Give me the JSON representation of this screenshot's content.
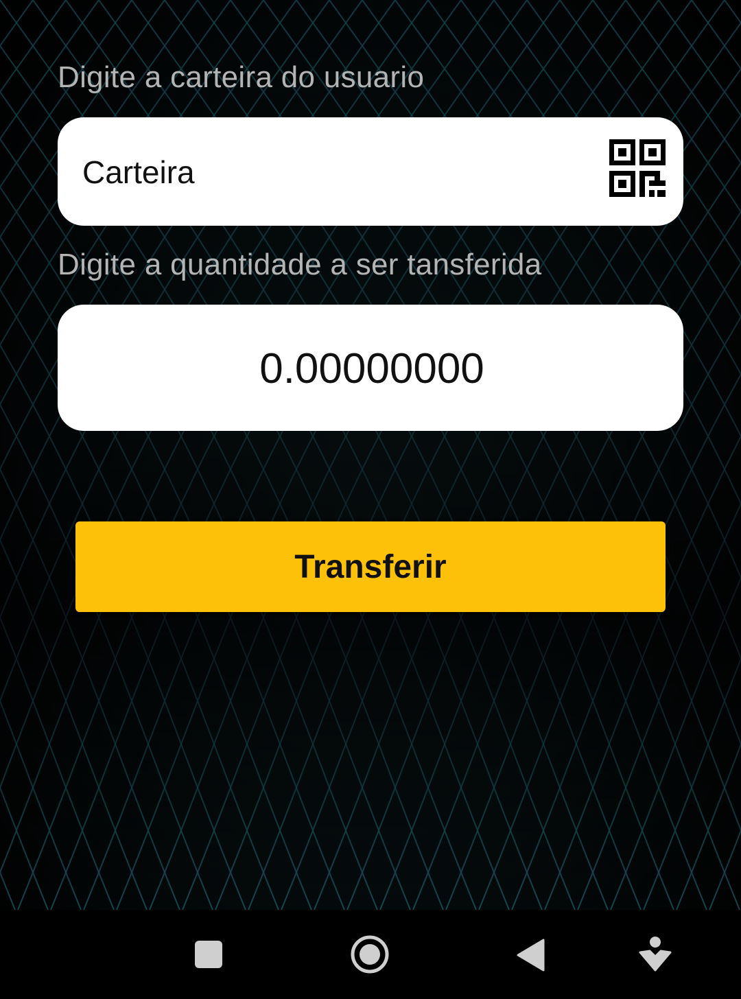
{
  "wallet": {
    "label": "Digite a carteira do usuario",
    "placeholder": "Carteira",
    "qr_icon": "qr-code-icon"
  },
  "amount": {
    "label": "Digite a quantidade a ser tansferida",
    "value": "0.00000000"
  },
  "actions": {
    "transfer_label": "Transferir"
  },
  "nav_bar": {
    "icons": [
      "recents-square-icon",
      "home-circle-icon",
      "back-triangle-icon",
      "accessibility-person-icon"
    ]
  },
  "colors": {
    "button": "#fdc10a",
    "grid_lines": "#1f6a78",
    "field_bg": "#ffffff",
    "label_text": "#b4b4b4"
  }
}
